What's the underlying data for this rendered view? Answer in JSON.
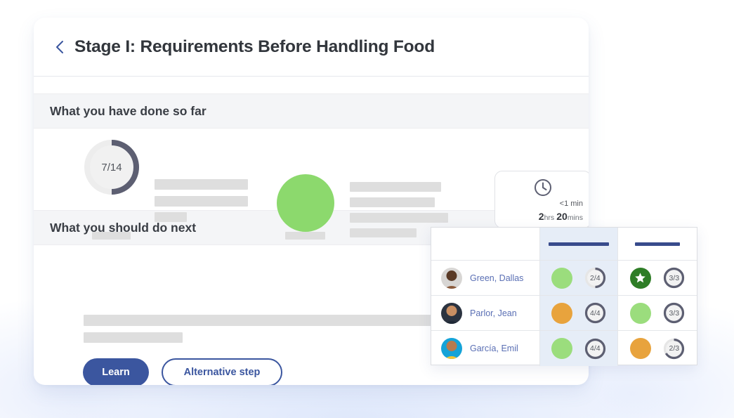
{
  "header": {
    "back_icon": "chevron-left-icon",
    "title": "Stage I: Requirements Before Handling Food"
  },
  "sections": {
    "done": {
      "label": "What you have done so far"
    },
    "next": {
      "label": "What you should do next"
    }
  },
  "progress": {
    "ring_label": "7/14",
    "ring_value": 7,
    "ring_total": 14,
    "ring_color": "#5d5f72",
    "ring_track": "#ededed",
    "green_circle_color": "#8cd96d"
  },
  "time_card": {
    "icon": "clock-icon",
    "rows": [
      {
        "value": "<1 min",
        "bold": "",
        "unit": ""
      },
      {
        "value": "",
        "bold_a": "2",
        "unit_a": "hrs",
        "bold_b": "20",
        "unit_b": "mins"
      }
    ],
    "short_time": "<1 min",
    "long_time_num1": "2",
    "long_time_unit1": "hrs",
    "long_time_num2": "20",
    "long_time_unit2": "mins"
  },
  "buttons": {
    "primary": "Learn",
    "secondary": "Alternative step",
    "primary_color": "#3b569f"
  },
  "table": {
    "columns": [
      {
        "header_bar": true,
        "width": "name"
      },
      {
        "header_bar": true,
        "highlight": true
      },
      {
        "header_bar": true,
        "highlight": false
      }
    ],
    "rows": [
      {
        "name": "Green, Dallas",
        "avatar": "avatar-green-dallas",
        "col1": {
          "status_color": "#9bdd7d",
          "icon": "",
          "ring_label": "2/4",
          "ring_value": 2,
          "ring_total": 4
        },
        "col2": {
          "status_color": "#2e7d26",
          "icon": "star-icon",
          "ring_label": "3/3",
          "ring_value": 3,
          "ring_total": 3
        }
      },
      {
        "name": "Parlor, Jean",
        "avatar": "avatar-parlor-jean",
        "col1": {
          "status_color": "#e8a33d",
          "icon": "",
          "ring_label": "4/4",
          "ring_value": 4,
          "ring_total": 4
        },
        "col2": {
          "status_color": "#9bdd7d",
          "icon": "",
          "ring_label": "3/3",
          "ring_value": 3,
          "ring_total": 3
        }
      },
      {
        "name": "García, Emil",
        "avatar": "avatar-garcia-emil",
        "col1": {
          "status_color": "#9bdd7d",
          "icon": "",
          "ring_label": "4/4",
          "ring_value": 4,
          "ring_total": 4
        },
        "col2": {
          "status_color": "#e8a33d",
          "icon": "",
          "ring_label": "2/3",
          "ring_value": 2,
          "ring_total": 3
        }
      }
    ]
  }
}
